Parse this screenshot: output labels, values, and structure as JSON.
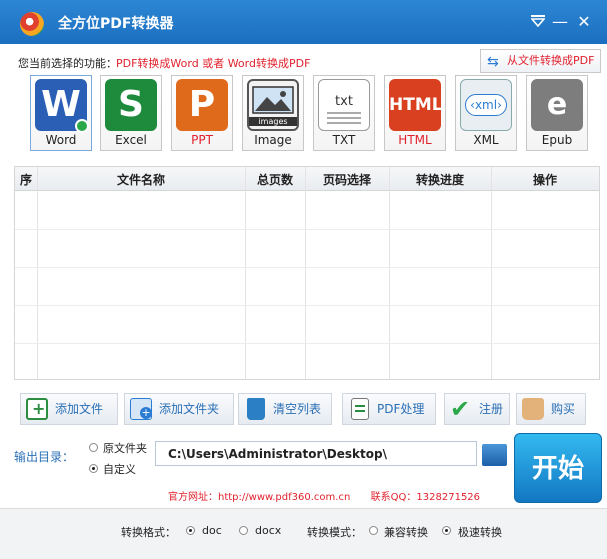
{
  "titlebar": {
    "title": "全方位PDF转换器",
    "min_label": "—",
    "close_label": "✕"
  },
  "function": {
    "label": "您当前选择的功能：",
    "value": "PDF转换成Word 或者 Word转换成PDF",
    "from_file_label": "从文件转换成PDF"
  },
  "formats": [
    {
      "label": "Word"
    },
    {
      "label": "Excel"
    },
    {
      "label": "PPT"
    },
    {
      "label": "Image"
    },
    {
      "label": "TXT"
    },
    {
      "label": "HTML"
    },
    {
      "label": "XML"
    },
    {
      "label": "Epub"
    }
  ],
  "icons": {
    "ppt_letter": "P",
    "excel_letter": "S",
    "word_letter": "W",
    "image_text": "images",
    "txt_text": "txt",
    "html_text": "HTML",
    "xml_text": "xml",
    "epub_letter": "e"
  },
  "table": {
    "headers": [
      "序",
      "文件名称",
      "总页数",
      "页码选择",
      "转换进度",
      "操作"
    ]
  },
  "toolbar": {
    "add_file": "添加文件",
    "add_folder": "添加文件夹",
    "clear_list": "清空列表",
    "pdf_process": "PDF处理",
    "register": "注册",
    "buy": "购买"
  },
  "output": {
    "label": "输出目录：",
    "option_original": "原文件夹",
    "option_custom": "自定义",
    "path": "C:\\Users\\Administrator\\Desktop\\",
    "start_label": "开始"
  },
  "contact": {
    "website": "官方网址：http://www.pdf360.com.cn",
    "qq": "联系QQ：1328271526"
  },
  "footer": {
    "format_label": "转换格式：",
    "opt_doc": "doc",
    "opt_docx": "docx",
    "mode_label": "转换模式：",
    "opt_compat": "兼容转换",
    "opt_fast": "极速转换"
  },
  "colors": {
    "accent": "#1c6fc0",
    "red_text": "#e0212d",
    "word": "#2b5fb5",
    "excel": "#1e8a3c",
    "ppt": "#e06a1b",
    "html": "#d8401f"
  }
}
